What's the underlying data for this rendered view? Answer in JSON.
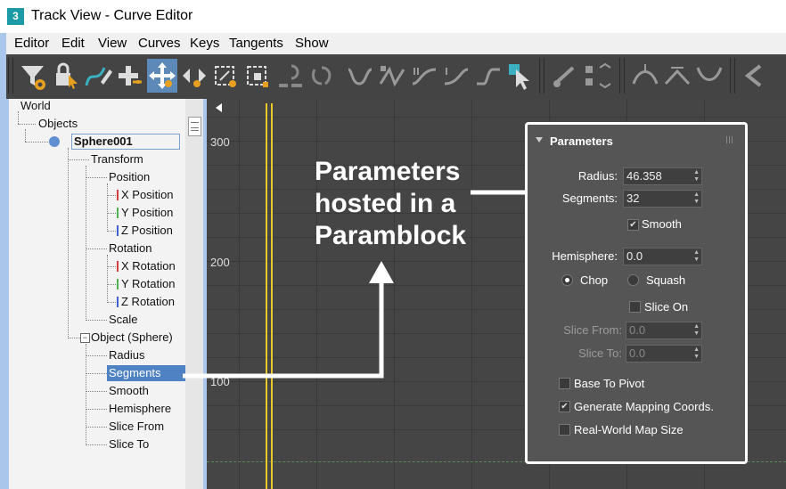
{
  "window": {
    "title": "Track View - Curve Editor",
    "app_icon": "3"
  },
  "menu": [
    "Editor",
    "Edit",
    "View",
    "Curves",
    "Keys",
    "Tangents",
    "Show"
  ],
  "tree": {
    "world": "World",
    "objects": "Objects",
    "sphere": "Sphere001",
    "transform": "Transform",
    "position": "Position",
    "x_position": "X Position",
    "y_position": "Y Position",
    "z_position": "Z Position",
    "rotation": "Rotation",
    "x_rotation": "X Rotation",
    "y_rotation": "Y Rotation",
    "z_rotation": "Z Rotation",
    "scale": "Scale",
    "object_sphere": "Object (Sphere)",
    "radius": "Radius",
    "segments": "Segments",
    "smooth": "Smooth",
    "hemisphere": "Hemisphere",
    "slice_from": "Slice From",
    "slice_to": "Slice To"
  },
  "graph": {
    "y_labels": [
      "300",
      "200",
      "100"
    ]
  },
  "annotation": {
    "line1": "Parameters",
    "line2": "hosted in a",
    "line3": "Paramblock"
  },
  "parameters": {
    "title": "Parameters",
    "radius_label": "Radius:",
    "radius_value": "46.358",
    "segments_label": "Segments:",
    "segments_value": "32",
    "smooth_label": "Smooth",
    "hemisphere_label": "Hemisphere:",
    "hemisphere_value": "0.0",
    "chop_label": "Chop",
    "squash_label": "Squash",
    "slice_on_label": "Slice On",
    "slice_from_label": "Slice From:",
    "slice_from_value": "0.0",
    "slice_to_label": "Slice To:",
    "slice_to_value": "0.0",
    "base_to_pivot_label": "Base To Pivot",
    "gen_mapping_label": "Generate Mapping Coords.",
    "real_world_label": "Real-World Map Size"
  },
  "colors": {
    "accent": "#4f82c2",
    "curve_yellow": "#e8c82a",
    "x_axis": "#d04040",
    "y_axis": "#50b050",
    "z_axis": "#4060d0"
  }
}
